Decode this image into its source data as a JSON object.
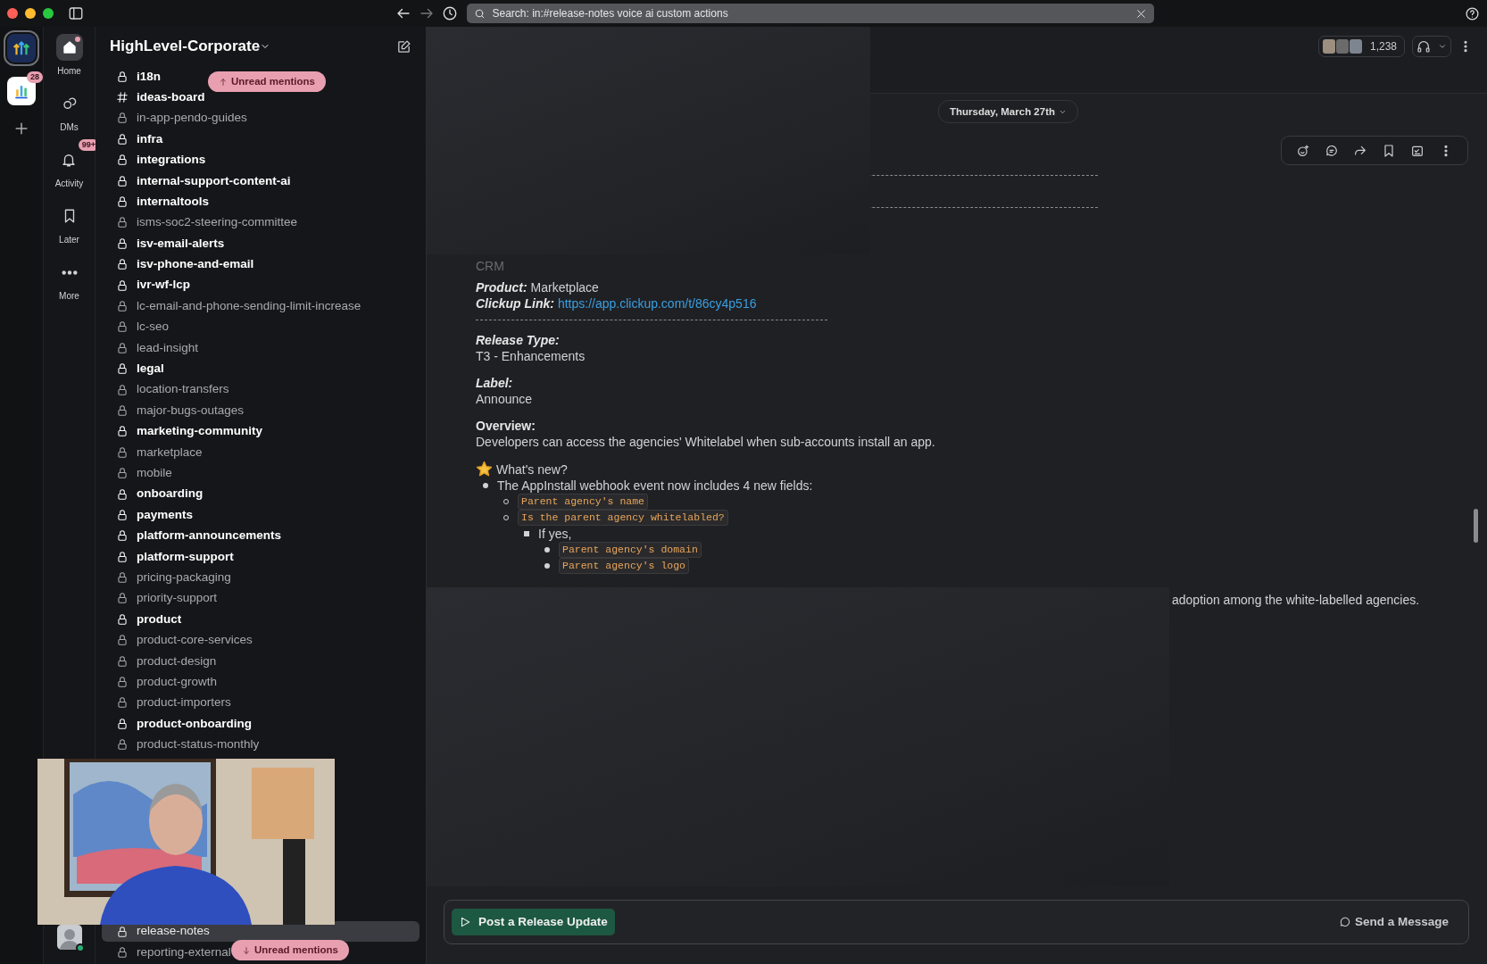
{
  "search": {
    "value": "Search: in:#release-notes voice ai custom actions"
  },
  "workspaces": [
    {
      "kind": "logo",
      "selected": true
    },
    {
      "kind": "chart",
      "selected": false,
      "badge": "28"
    }
  ],
  "nav": [
    {
      "label": "Home",
      "selected": true,
      "dot": true
    },
    {
      "label": "DMs",
      "selected": false
    },
    {
      "label": "Activity",
      "selected": false,
      "badge": "99+"
    },
    {
      "label": "Later",
      "selected": false
    },
    {
      "label": "More",
      "selected": false
    }
  ],
  "sidebar": {
    "workspace_name": "HighLevel-Corporate",
    "unread_top": {
      "label": "Unread mentions"
    },
    "channels": [
      {
        "name": "i18n",
        "kind": "private",
        "unread": true,
        "selected": false
      },
      {
        "name": "ideas-board",
        "kind": "public",
        "unread": true,
        "selected": false
      },
      {
        "name": "in-app-pendo-guides",
        "kind": "private",
        "unread": false,
        "selected": false
      },
      {
        "name": "infra",
        "kind": "private",
        "unread": true,
        "selected": false
      },
      {
        "name": "integrations",
        "kind": "private",
        "unread": true,
        "selected": false
      },
      {
        "name": "internal-support-content-ai",
        "kind": "private",
        "unread": true,
        "selected": false
      },
      {
        "name": "internaltools",
        "kind": "private",
        "unread": true,
        "selected": false
      },
      {
        "name": "isms-soc2-steering-committee",
        "kind": "private",
        "unread": false,
        "selected": false
      },
      {
        "name": "isv-email-alerts",
        "kind": "private",
        "unread": true,
        "selected": false
      },
      {
        "name": "isv-phone-and-email",
        "kind": "private",
        "unread": true,
        "selected": false
      },
      {
        "name": "ivr-wf-lcp",
        "kind": "private",
        "unread": true,
        "selected": false
      },
      {
        "name": "lc-email-and-phone-sending-limit-increase",
        "kind": "private",
        "unread": false,
        "selected": false
      },
      {
        "name": "lc-seo",
        "kind": "private",
        "unread": false,
        "selected": false
      },
      {
        "name": "lead-insight",
        "kind": "private",
        "unread": false,
        "selected": false
      },
      {
        "name": "legal",
        "kind": "private",
        "unread": true,
        "selected": false
      },
      {
        "name": "location-transfers",
        "kind": "private",
        "unread": false,
        "selected": false
      },
      {
        "name": "major-bugs-outages",
        "kind": "private",
        "unread": false,
        "selected": false
      },
      {
        "name": "marketing-community",
        "kind": "private",
        "unread": true,
        "selected": false
      },
      {
        "name": "marketplace",
        "kind": "private",
        "unread": false,
        "selected": false
      },
      {
        "name": "mobile",
        "kind": "private",
        "unread": false,
        "selected": false
      },
      {
        "name": "onboarding",
        "kind": "private",
        "unread": true,
        "selected": false
      },
      {
        "name": "payments",
        "kind": "private",
        "unread": true,
        "selected": false
      },
      {
        "name": "platform-announcements",
        "kind": "private",
        "unread": true,
        "selected": false
      },
      {
        "name": "platform-support",
        "kind": "private",
        "unread": true,
        "selected": false
      },
      {
        "name": "pricing-packaging",
        "kind": "private",
        "unread": false,
        "selected": false
      },
      {
        "name": "priority-support",
        "kind": "private",
        "unread": false,
        "selected": false
      },
      {
        "name": "product",
        "kind": "private",
        "unread": true,
        "selected": false
      },
      {
        "name": "product-core-services",
        "kind": "private",
        "unread": false,
        "selected": false
      },
      {
        "name": "product-design",
        "kind": "private",
        "unread": false,
        "selected": false
      },
      {
        "name": "product-growth",
        "kind": "private",
        "unread": false,
        "selected": false
      },
      {
        "name": "product-importers",
        "kind": "private",
        "unread": false,
        "selected": false
      },
      {
        "name": "product-onboarding",
        "kind": "private",
        "unread": true,
        "selected": false
      },
      {
        "name": "product-status-monthly",
        "kind": "private",
        "unread": false,
        "selected": false
      }
    ],
    "channels_below": [
      {
        "name": "release-notes",
        "kind": "private",
        "unread": false,
        "selected": true
      },
      {
        "name": "reporting-external",
        "kind": "private",
        "unread": false,
        "selected": false
      }
    ],
    "unread_bottom": {
      "label": "Unread mentions"
    }
  },
  "user": {
    "online": true
  },
  "header": {
    "member_count": "1,238"
  },
  "date_divider": "Thursday, March 27th",
  "message": [
    {
      "kind": "faded",
      "text": "CRM"
    },
    {
      "kind": "inline",
      "label": "Product:",
      "value": "Marketplace"
    },
    {
      "kind": "link",
      "label": "Clickup Link:",
      "value": "https://app.clickup.com/t/86cy4p516"
    },
    {
      "kind": "rule"
    },
    {
      "kind": "block",
      "label": "Release Type:",
      "value": "T3 - Enhancements"
    },
    {
      "kind": "block",
      "label": "Label:",
      "value": "Announce"
    },
    {
      "kind": "section",
      "label": "Overview:",
      "value": "Developers can access the agencies' Whitelabel when sub-accounts install an app."
    },
    {
      "kind": "star",
      "text": "What's new?"
    },
    {
      "kind": "list",
      "items": [
        {
          "kind": "text",
          "text": "The AppInstall webhook event now includes 4 new fields:",
          "children": [
            {
              "kind": "code",
              "text": "Parent agency's name"
            },
            {
              "kind": "code",
              "text": "Is the parent agency whitelabled?",
              "children": [
                {
                  "kind": "text",
                  "text": "If yes,",
                  "children": [
                    {
                      "kind": "code",
                      "text": "Parent agency's domain"
                    },
                    {
                      "kind": "code",
                      "text": "Parent agency's logo"
                    }
                  ]
                }
              ]
            }
          ]
        }
      ]
    }
  ],
  "fragment": "adoption among the white-labelled agencies.",
  "composer": {
    "post_button": "Post a Release Update",
    "send_button": "Send a Message"
  }
}
